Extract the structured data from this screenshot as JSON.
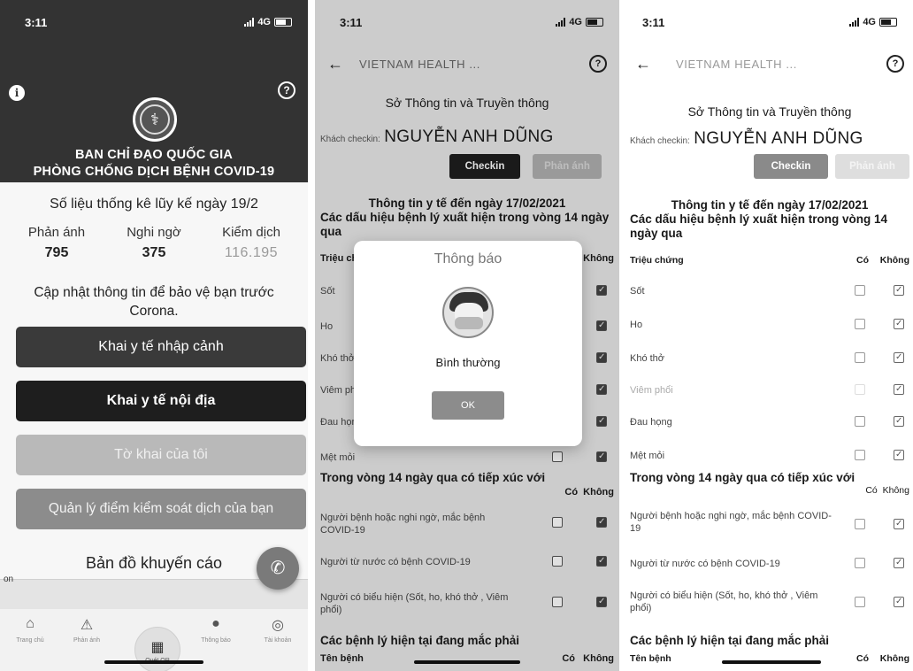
{
  "status": {
    "time": "3:11",
    "network": "4G"
  },
  "home": {
    "header_title_line1": "BAN CHỈ ĐẠO QUỐC GIA",
    "header_title_line2": "PHÒNG CHỐNG DỊCH BỆNH COVID-19",
    "stats_title": "Số liệu thống kê lũy kế ngày 19/2",
    "stats": [
      {
        "label": "Phản ánh",
        "value": "795"
      },
      {
        "label": "Nghi ngờ",
        "value": "375"
      },
      {
        "label": "Kiểm dịch",
        "value": "116.195"
      }
    ],
    "update_text": "Cập nhật thông tin để bảo vệ bạn trước Corona.",
    "buttons": [
      "Khai y tế nhập cảnh",
      "Khai y tế nội địa",
      "Tờ khai của tôi",
      "Quản lý điểm kiểm soát dịch của bạn"
    ],
    "map_title": "Bản đồ khuyến cáo",
    "map_label": "on",
    "tabs": [
      {
        "label": "Trang chủ",
        "icon": "home-icon"
      },
      {
        "label": "Phản ánh",
        "icon": "warning-icon"
      },
      {
        "label": "Quét QR",
        "icon": "qr-scan-icon"
      },
      {
        "label": "Thông báo",
        "icon": "notification-icon"
      },
      {
        "label": "Tài khoản",
        "icon": "account-icon"
      }
    ]
  },
  "form": {
    "nav_title": "VIETNAM HEALTH ...",
    "org": "Sở Thông tin và Truyền thông",
    "guest_label": "Khách checkin:",
    "guest_name": "NGUYỄN ANH DŨNG",
    "checkin_label": "Checkin",
    "report_label": "Phản ánh",
    "date_heading": "Thông tin y tế đến ngày 17/02/2021",
    "symptoms_heading": "Các dấu hiệu bệnh lý xuất hiện trong vòng 14 ngày qua",
    "symptom_col": "Triệu chứng",
    "yes_col": "Có",
    "no_col": "Không",
    "symptoms": [
      "Sốt",
      "Ho",
      "Khó thở",
      "Viêm phổi",
      "Đau họng",
      "Mệt mỏi"
    ],
    "contact_heading": "Trong vòng 14 ngày qua có tiếp xúc với",
    "contacts": [
      "Người bệnh hoặc nghi ngờ, mắc bệnh COVID-19",
      "Người từ nước có bệnh COVID-19",
      "Người có biểu hiện (Sốt, ho, khó thở , Viêm phổi)"
    ],
    "diseases_heading": "Các bệnh lý hiện tại đang mắc phải",
    "disease_col": "Tên bệnh"
  },
  "modal": {
    "title": "Thông báo",
    "status": "Bình thường",
    "ok_label": "OK"
  }
}
